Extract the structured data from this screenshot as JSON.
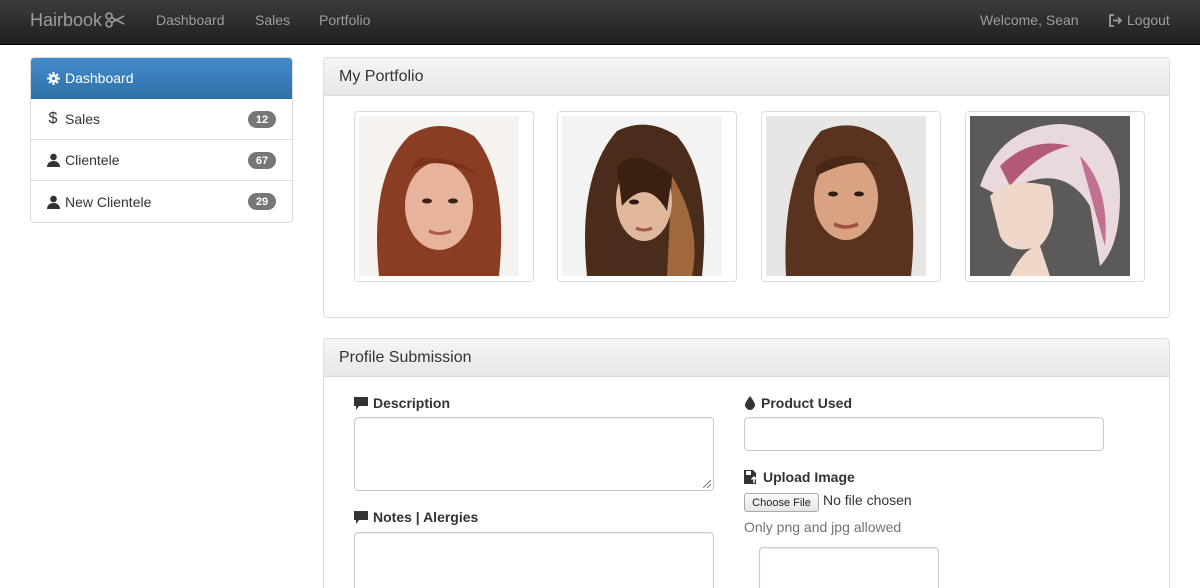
{
  "navbar": {
    "brand": "Hairbook",
    "brand_icon": "scissors-icon",
    "links": [
      "Dashboard",
      "Sales",
      "Portfolio"
    ],
    "welcome": "Welcome, Sean",
    "logout": "Logout",
    "logout_icon": "logout-icon"
  },
  "sidebar": {
    "active_color": "#3276b1",
    "items": [
      {
        "label": "Dashboard",
        "icon": "gear-icon",
        "badge": ""
      },
      {
        "label": "Sales",
        "icon": "dollar-icon",
        "badge": "12"
      },
      {
        "label": "Clientele",
        "icon": "user-icon",
        "badge": "67"
      },
      {
        "label": "New Clientele",
        "icon": "user-icon",
        "badge": "29"
      }
    ]
  },
  "portfolio": {
    "title": "My Portfolio",
    "photos": [
      "portrait-photo-1",
      "portrait-photo-2",
      "portrait-photo-3",
      "portrait-photo-4"
    ]
  },
  "profile": {
    "title": "Profile Submission",
    "description_label": "Description",
    "notes_label": "Notes | Alergies",
    "product_label": "Product Used",
    "upload_label": "Upload Image",
    "choose_file": "Choose File",
    "no_file": "No file chosen",
    "helper": "Only png and jpg allowed"
  }
}
